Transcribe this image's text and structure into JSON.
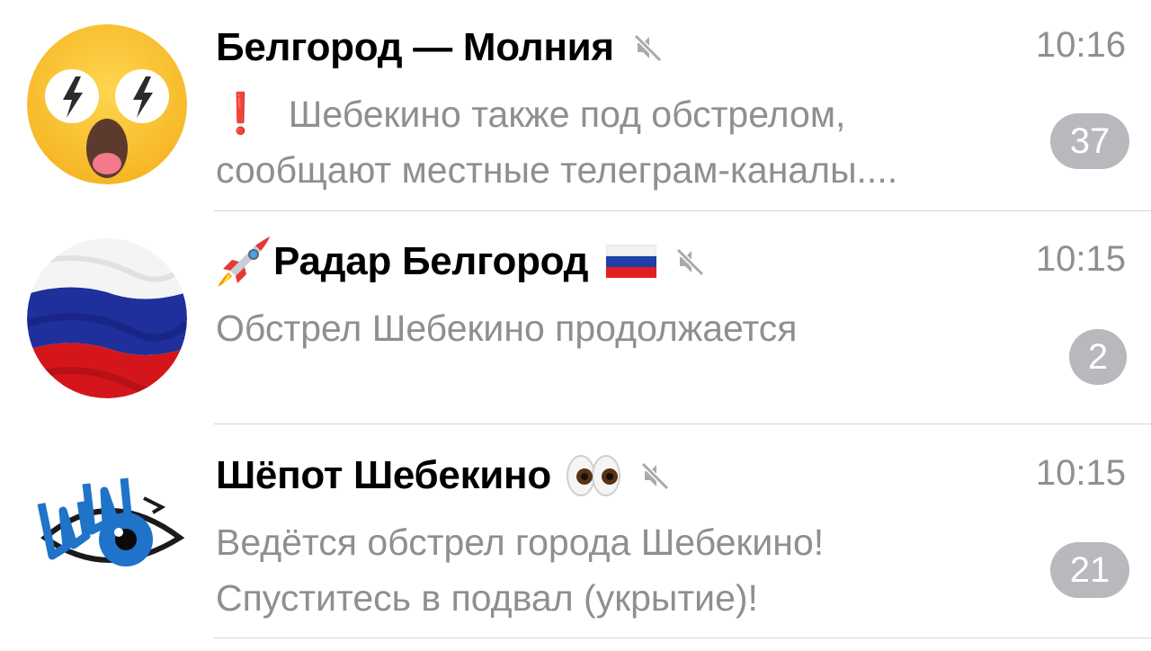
{
  "colors": {
    "title": "#000000",
    "secondary": "#8e8e93",
    "badge_bg": "#b8b8bd",
    "divider": "#d6d6da",
    "exclaim": "#e8141c"
  },
  "chats": [
    {
      "title": "Белгород — Молния",
      "time": "10:16",
      "muted": true,
      "preview_prefix": "❗",
      "preview_lines": [
        "Шебекино также под обстрелом,",
        "сообщают местные телеграм-каналы...."
      ],
      "unread": "37",
      "avatar": "shocked-lightning-face"
    },
    {
      "title_prefix_icon": "rocket-icon",
      "title": "Радар Белгород",
      "title_suffix_icon": "russia-flag-icon",
      "time": "10:15",
      "muted": true,
      "preview_lines": [
        "Обстрел Шебекино продолжается"
      ],
      "unread": "2",
      "avatar": "russian-flag"
    },
    {
      "title": "Шёпот Шебекино",
      "title_suffix_icon": "eyes-icon",
      "time": "10:15",
      "muted": true,
      "preview_lines": [
        "Ведётся обстрел города Шебекино!",
        "Спуститесь в подвал (укрытие)!"
      ],
      "unread": "21",
      "avatar": "shsh-eye-logo"
    }
  ]
}
